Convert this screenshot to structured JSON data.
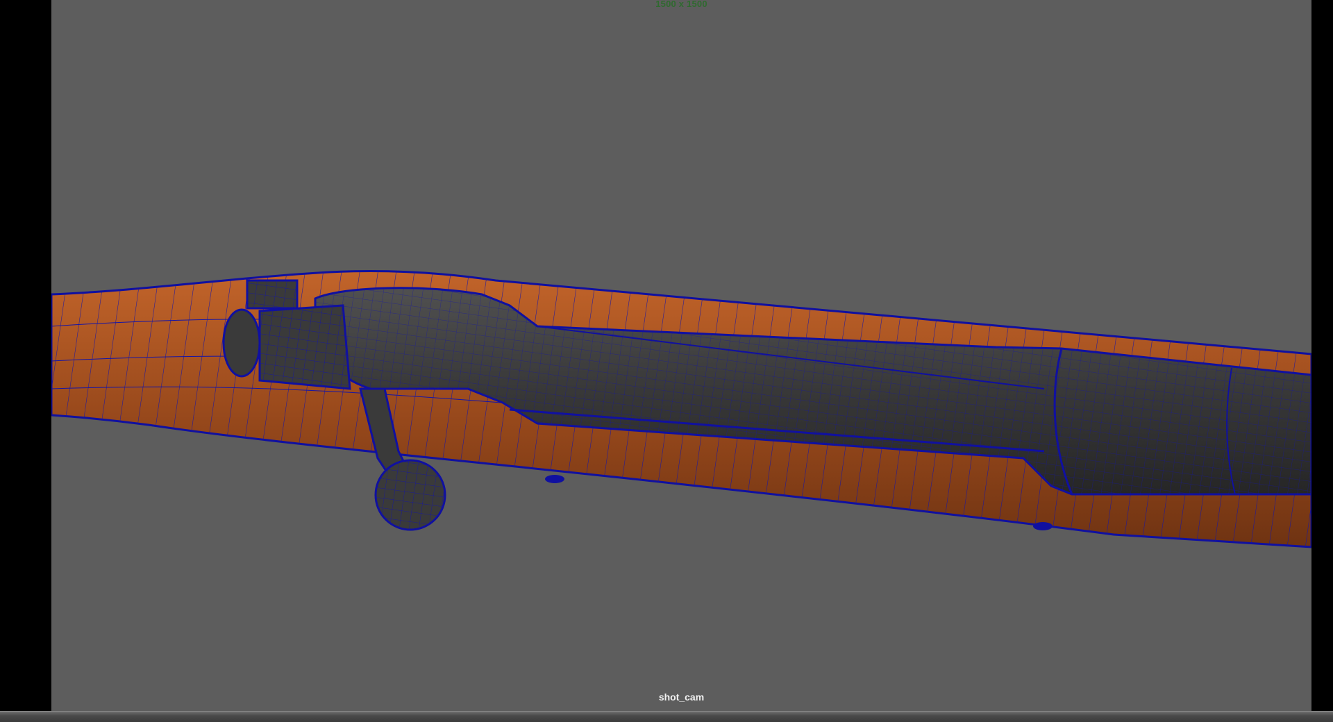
{
  "viewport": {
    "resolution_label": "1500 x 1500",
    "camera_label": "shot_cam"
  },
  "colors": {
    "viewport_background": "#5d5d5d",
    "resolution_text": "#2f6a2f",
    "camera_text": "#f2f2f2",
    "wireframe": "#1010a0",
    "wood": "#9a4a1c",
    "metal": "#3a3a3a"
  },
  "scene": {
    "object": "rifle-model-wireframe-on-shaded"
  }
}
